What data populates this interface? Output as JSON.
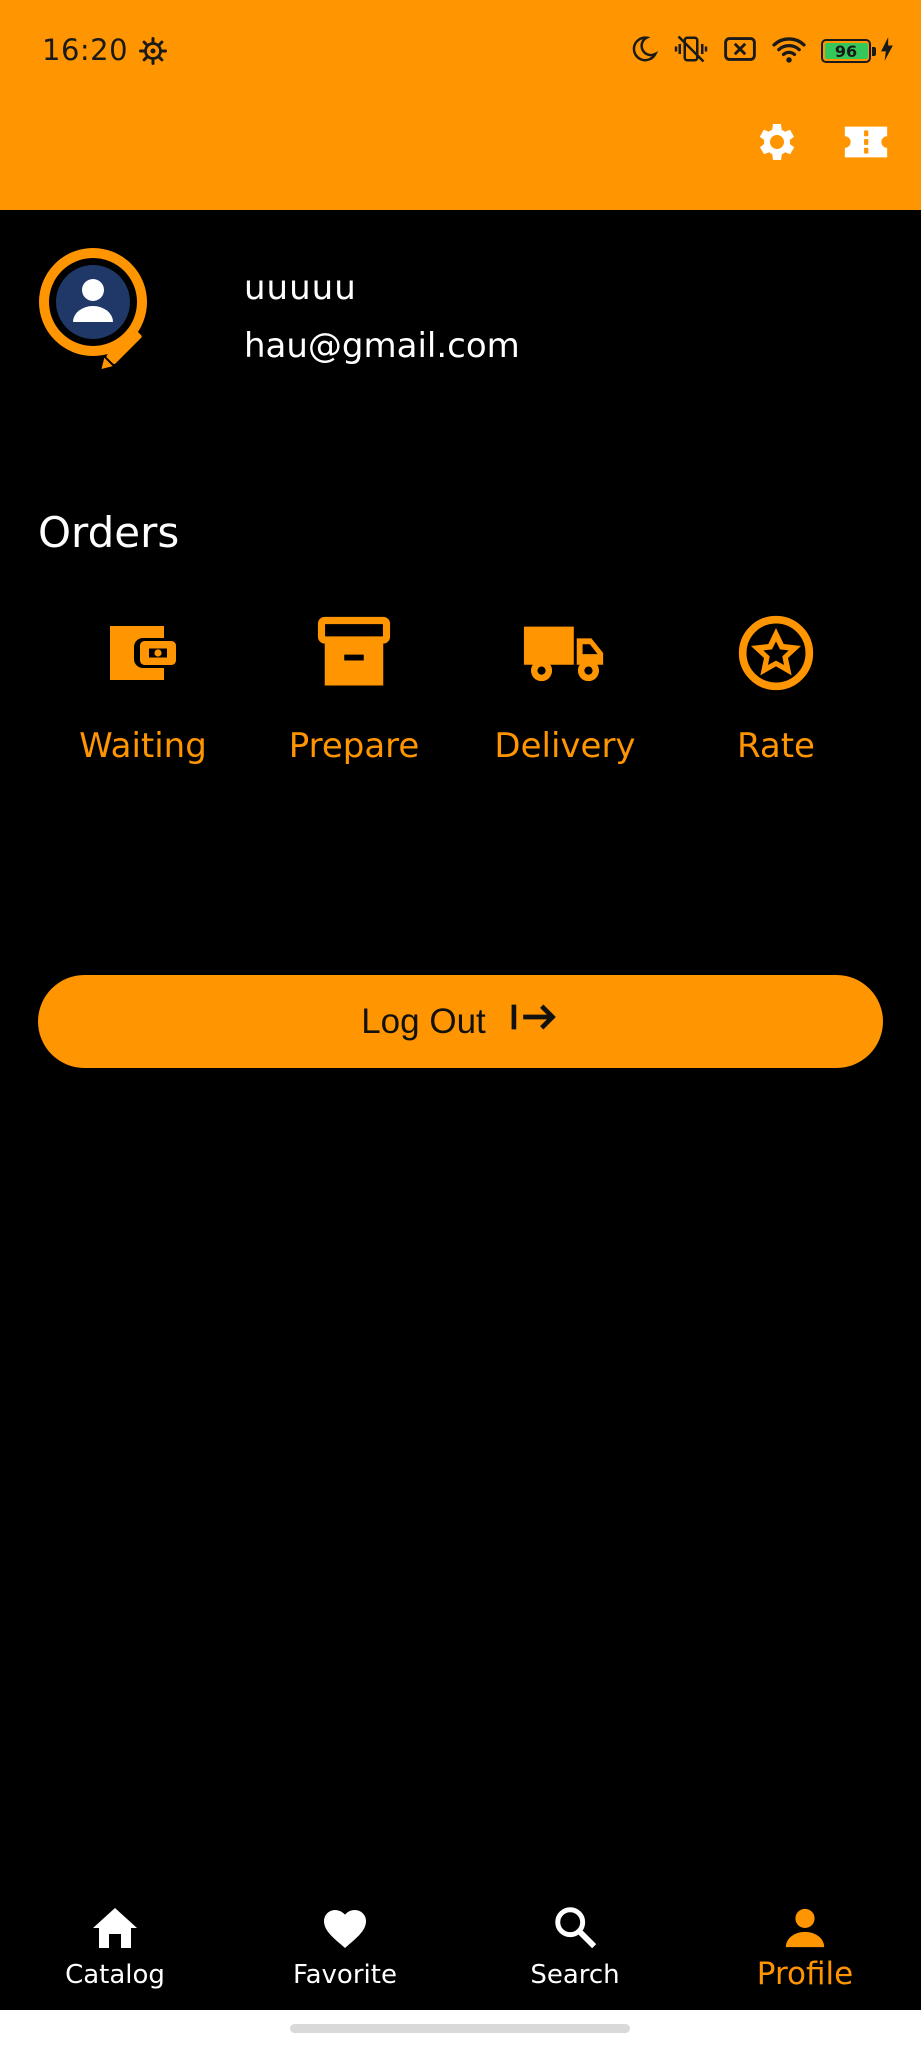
{
  "status_bar": {
    "time": "16:20",
    "battery_level": "96",
    "icons": [
      "settings-gear-icon",
      "moon-icon",
      "vibrate-off-icon",
      "no-sim-icon",
      "wifi-icon",
      "battery-icon",
      "charging-icon"
    ]
  },
  "header": {
    "actions": [
      "settings-icon",
      "ticket-icon"
    ],
    "colors": {
      "accent": "#FF9500",
      "background": "#000000"
    }
  },
  "profile": {
    "username": "uuuuu",
    "email": "hau@gmail.com",
    "avatar_icon": "user-avatar-icon",
    "edit_icon": "pencil-icon"
  },
  "orders": {
    "title": "Orders",
    "items": [
      {
        "label": "Waiting",
        "icon": "wallet-icon"
      },
      {
        "label": "Prepare",
        "icon": "archive-box-icon"
      },
      {
        "label": "Delivery",
        "icon": "truck-icon"
      },
      {
        "label": "Rate",
        "icon": "star-circle-icon"
      }
    ]
  },
  "logout": {
    "label": "Log Out",
    "icon": "logout-arrow-icon"
  },
  "bottom_nav": {
    "items": [
      {
        "label": "Catalog",
        "icon": "home-icon",
        "active": false
      },
      {
        "label": "Favorite",
        "icon": "heart-icon",
        "active": false
      },
      {
        "label": "Search",
        "icon": "search-icon",
        "active": false
      },
      {
        "label": "Profile",
        "icon": "person-icon",
        "active": true
      }
    ]
  }
}
